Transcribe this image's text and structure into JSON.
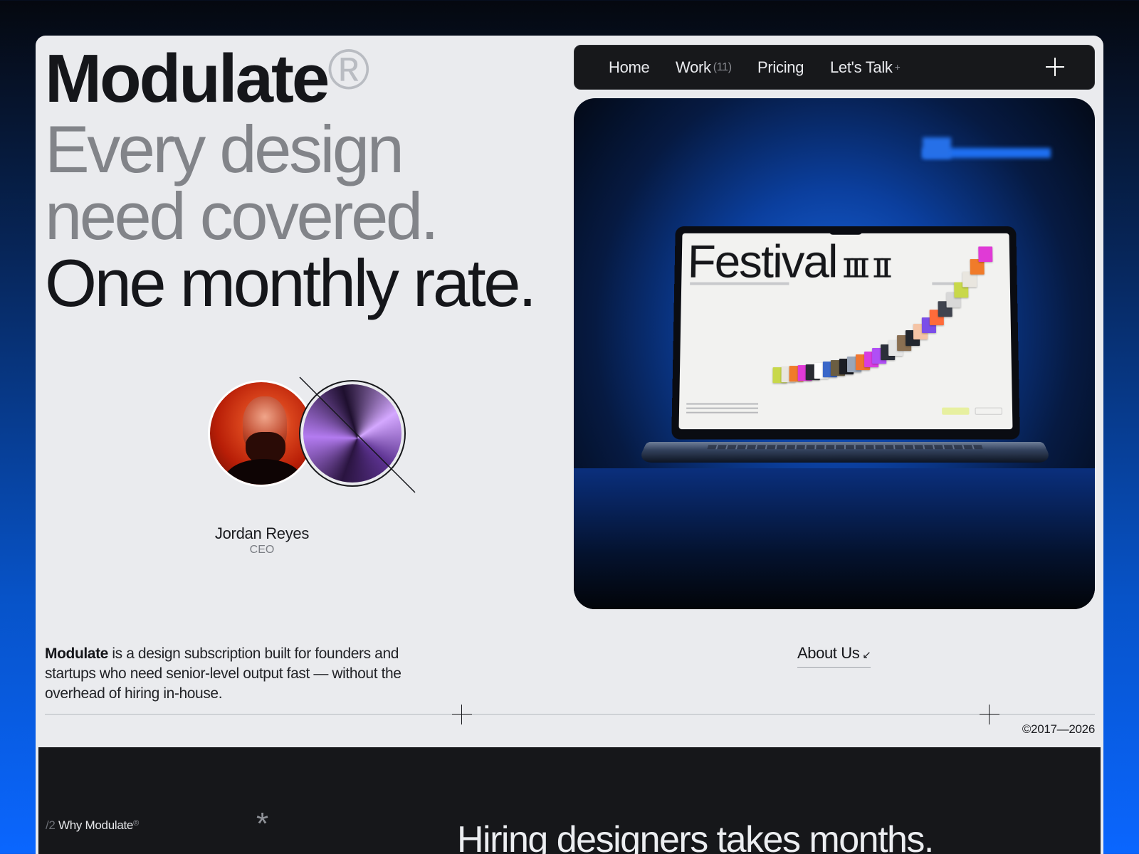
{
  "brand": {
    "name": "Modulate",
    "registered": "®"
  },
  "headline": {
    "line2": "Every design",
    "line3": "need covered.",
    "line4": "One monthly rate."
  },
  "nav": {
    "items": [
      {
        "label": "Home"
      },
      {
        "label": "Work",
        "count": "(11)"
      },
      {
        "label": "Pricing"
      },
      {
        "label": "Let's Talk",
        "suffix": "+"
      }
    ],
    "menu_icon": "plus-icon"
  },
  "profile": {
    "name": "Jordan Reyes",
    "role": "CEO"
  },
  "hero_image": {
    "screen_title": "Festival",
    "screen_title_glyphs": "ɪɪɪ ɪɪ"
  },
  "intro": {
    "brand": "Modulate",
    "text": " is a design subscription built for founders and startups who need senior-level output fast — without the overhead of hiring in-house."
  },
  "about_link": {
    "label": "About Us",
    "icon": "arrow-down-left-icon",
    "arrow": "↙"
  },
  "copyright": "©2017—2026",
  "section2": {
    "number": "/2",
    "label": "Why Modulate",
    "registered": "®",
    "asterisk": "*",
    "heading": "Hiring designers takes months."
  },
  "colors": {
    "page_bg": "#eaebee",
    "ink": "#15161a",
    "muted": "#828489",
    "nav_bg": "#17181b",
    "accent_blue": "#0a66ff"
  }
}
